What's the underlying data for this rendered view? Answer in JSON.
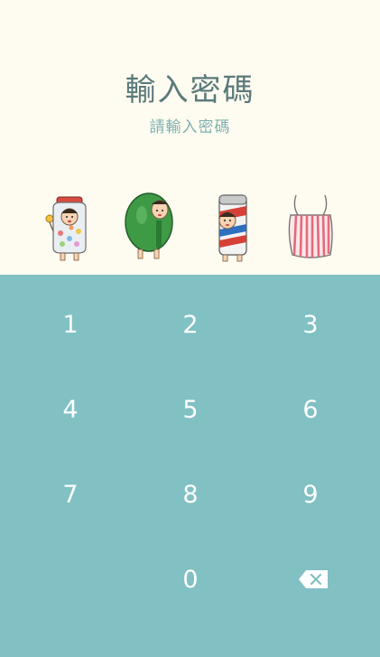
{
  "header": {
    "title": "輸入密碼",
    "subtitle": "請輸入密碼"
  },
  "pin_slots": [
    {
      "icon": "candy-jar-character-icon",
      "filled": false
    },
    {
      "icon": "green-bean-character-icon",
      "filled": false
    },
    {
      "icon": "drink-can-character-icon",
      "filled": false
    },
    {
      "icon": "striped-plastic-bag-icon",
      "filled": false
    }
  ],
  "keypad": {
    "keys": [
      "1",
      "2",
      "3",
      "4",
      "5",
      "6",
      "7",
      "8",
      "9",
      "0"
    ],
    "backspace_icon": "backspace-icon"
  },
  "colors": {
    "top_background": "#fefbf0",
    "keypad_background": "#81c0c3",
    "title": "#5a7a7a",
    "subtitle": "#7fb1b2"
  }
}
